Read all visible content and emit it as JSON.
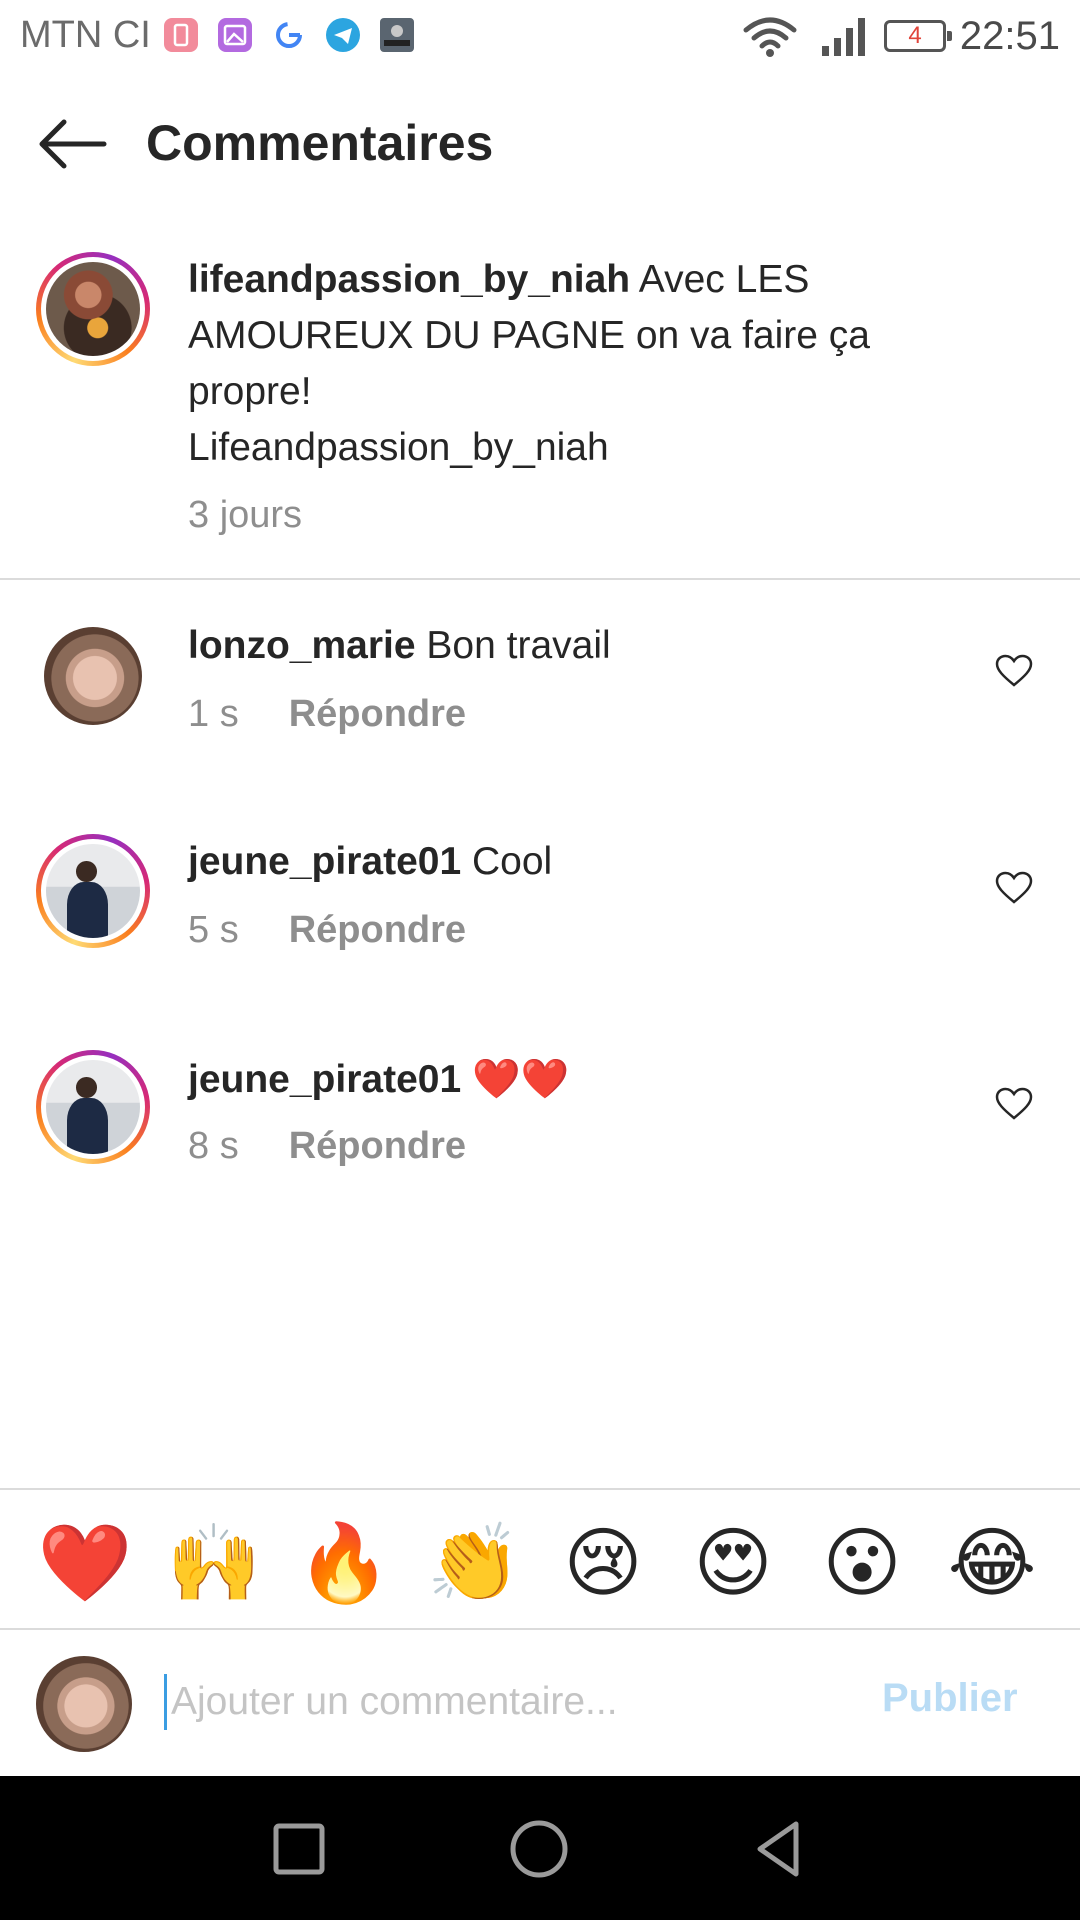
{
  "status_bar": {
    "carrier": "MTN CI",
    "battery_level": "4",
    "time": "22:51",
    "notification_icons": [
      "battery-saver-icon",
      "gallery-icon",
      "google-icon",
      "telegram-icon",
      "call-of-duty-icon"
    ]
  },
  "header": {
    "title": "Commentaires"
  },
  "caption": {
    "username": "lifeandpassion_by_niah",
    "text": " Avec LES AMOUREUX DU PAGNE on va faire ça propre!",
    "signature": "Lifeandpassion_by_niah",
    "time": "3 jours"
  },
  "comments": [
    {
      "username": "lonzo_marie",
      "text": " Bon travail",
      "time": "1 s",
      "reply_label": "Répondre"
    },
    {
      "username": "jeune_pirate01",
      "text": " Cool",
      "time": "5 s",
      "reply_label": "Répondre"
    },
    {
      "username": "jeune_pirate01",
      "text": " ❤️❤️",
      "time": "8 s",
      "reply_label": "Répondre"
    }
  ],
  "emoji_bar": {
    "emojis": [
      "❤️",
      "🙌",
      "🔥",
      "👏",
      "😢",
      "😍",
      "😮",
      "😂"
    ]
  },
  "composer": {
    "placeholder": "Ajouter un commentaire...",
    "value": "",
    "publish_label": "Publier"
  },
  "colors": {
    "primary_text": "#262626",
    "secondary_text": "#8e8e8e",
    "publish_disabled": "#b9dcf5",
    "divider": "#dbdbdb",
    "nav_background": "#000000"
  }
}
